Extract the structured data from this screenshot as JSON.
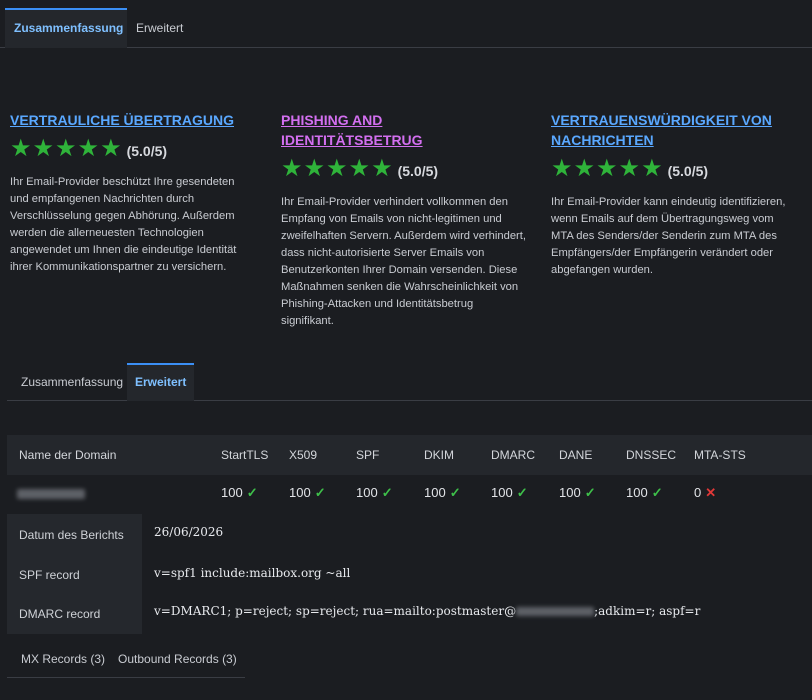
{
  "top_tabs": [
    {
      "label": "Zusammenfassung",
      "active": true
    },
    {
      "label": "Erweitert",
      "active": false
    }
  ],
  "cards": [
    {
      "title": "VERTRAULICHE ÜBERTRAGUNG",
      "title_color": "#5aa8ff",
      "rating": 5,
      "score": "(5.0/5)",
      "text": "Ihr Email-Provider beschützt Ihre gesendeten und empfangenen Nachrichten durch Verschlüsselung gegen Abhörung. Außerdem werden die allerneuesten Technologien angewendet um Ihnen die eindeutige Identität ihrer Kommunikationspartner zu versichern."
    },
    {
      "title": "PHISHING AND IDENTITÄTSBETRUG",
      "title_color": "#d36ff0",
      "rating": 5,
      "score": "(5.0/5)",
      "text": "Ihr Email-Provider verhindert vollkommen den Empfang von Emails von nicht-legitimen und zweifelhaften Servern. Außerdem wird verhindert, dass nicht-autorisierte Server Emails von Benutzerkonten Ihrer Domain versenden. Diese Maßnahmen senken die Wahrscheinlichkeit von Phishing-Attacken und Identitätsbetrug signifikant."
    },
    {
      "title": "VERTRAUENSWÜRDIGKEIT VON NACHRICHTEN",
      "title_color": "#5aa8ff",
      "rating": 5,
      "score": "(5.0/5)",
      "text": "Ihr Email-Provider kann eindeutig identifizieren, wenn Emails auf dem Übertragungsweg vom MTA des Senders/der Senderin zum MTA des Empfängers/der Empfängerin verändert oder abgefangen wurden."
    }
  ],
  "sub_tabs": [
    {
      "label": "Zusammenfassung",
      "active": false
    },
    {
      "label": "Erweitert",
      "active": true
    }
  ],
  "table": {
    "headers": [
      "Name der Domain",
      "StartTLS",
      "X509",
      "SPF",
      "DKIM",
      "DMARC",
      "DANE",
      "DNSSEC",
      "MTA-STS"
    ],
    "row": {
      "values": [
        {
          "score": "100",
          "ok": true
        },
        {
          "score": "100",
          "ok": true
        },
        {
          "score": "100",
          "ok": true
        },
        {
          "score": "100",
          "ok": true
        },
        {
          "score": "100",
          "ok": true
        },
        {
          "score": "100",
          "ok": true
        },
        {
          "score": "100",
          "ok": true
        },
        {
          "score": "0",
          "ok": false
        }
      ]
    }
  },
  "details": {
    "report_date_label": "Datum des Berichts",
    "report_date": "26/06/2026",
    "spf_label": "SPF record",
    "spf_value": "v=spf1 include:mailbox.org ~all",
    "dmarc_label": "DMARC record",
    "dmarc_prefix": "v=DMARC1; p=reject; sp=reject; rua=mailto:postmaster@",
    "dmarc_suffix": ";adkim=r; aspf=r"
  },
  "bottom_tabs": [
    {
      "label": "MX Records (3)"
    },
    {
      "label": "Outbound Records (3)"
    }
  ],
  "colors": {
    "accent": "#3b8ff5",
    "check": "#3ec04a",
    "cross": "#e23838",
    "star": "#2fb33a"
  }
}
